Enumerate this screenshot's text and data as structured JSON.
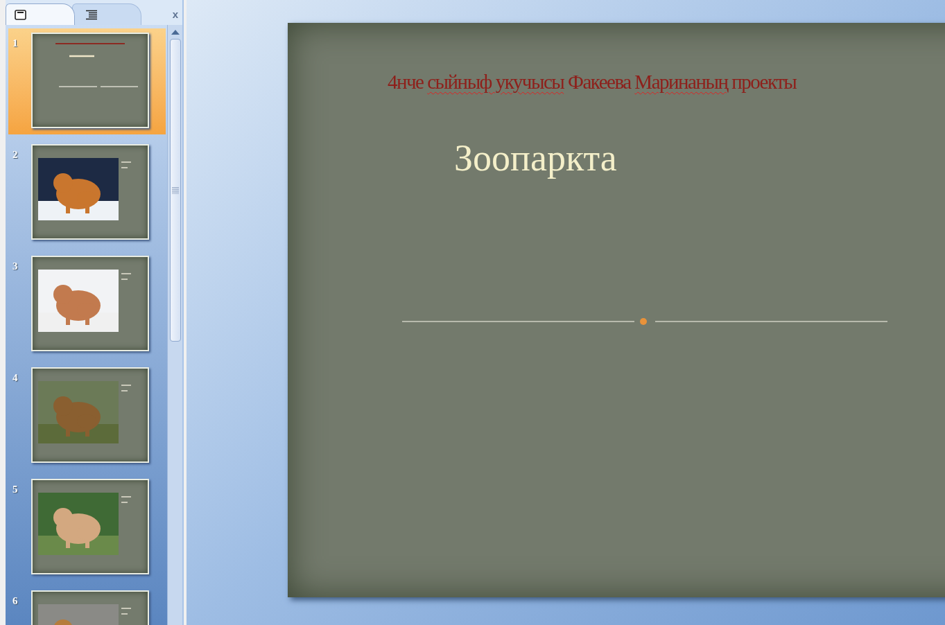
{
  "panel": {
    "tabs": [
      {
        "kind": "slides",
        "selected": true
      },
      {
        "kind": "outline",
        "selected": false
      }
    ],
    "close": "x"
  },
  "slides": [
    {
      "number": "1",
      "selected": true,
      "kind": "title"
    },
    {
      "number": "2",
      "selected": false
    },
    {
      "number": "3",
      "selected": false
    },
    {
      "number": "4",
      "selected": false
    },
    {
      "number": "5",
      "selected": false
    },
    {
      "number": "6",
      "selected": false
    }
  ],
  "current_slide": {
    "subtitle_segments": [
      {
        "text": "4нче ",
        "misspelled": false
      },
      {
        "text": "сыйныф укучысы",
        "misspelled": true
      },
      {
        "text": " Факеева ",
        "misspelled": false
      },
      {
        "text": "Маринаның",
        "misspelled": true
      },
      {
        "text": " проекты",
        "misspelled": false
      }
    ],
    "title": "Зоопаркта"
  }
}
